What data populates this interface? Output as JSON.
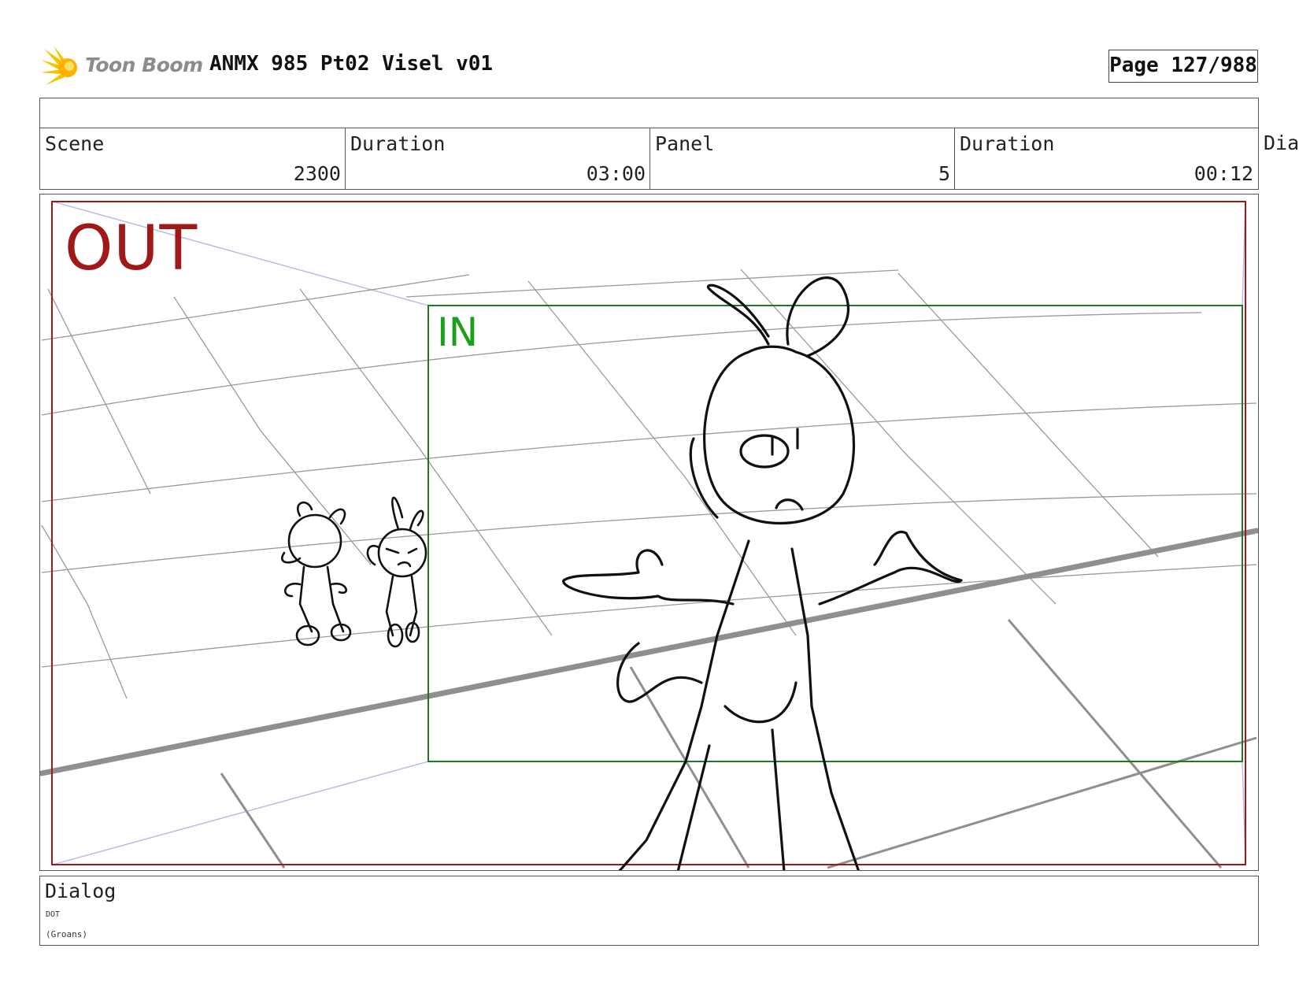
{
  "header": {
    "logo_text": "Toon Boom",
    "logo_icon": "starburst-logo-icon",
    "document_title": "ANMX 985 Pt02 Visel v01",
    "page_label": "Page 127/988"
  },
  "info": {
    "scene_label": "Scene",
    "scene_value": "2300",
    "scene_duration_label": "Duration",
    "scene_duration_value": "03:00",
    "panel_label": "Panel",
    "panel_value": "5",
    "panel_duration_label": "Duration",
    "panel_duration_value": "00:12",
    "overflow_label": "Dia"
  },
  "panel": {
    "out_label": "OUT",
    "in_label": "IN",
    "colors": {
      "out_frame": "#a01818",
      "in_frame": "#1f7a1f",
      "in_text": "#1aa01a",
      "camera_lines": "#b8b8e6"
    }
  },
  "dialog": {
    "label": "Dialog",
    "speaker": "DOT",
    "line": "(Groans)"
  }
}
